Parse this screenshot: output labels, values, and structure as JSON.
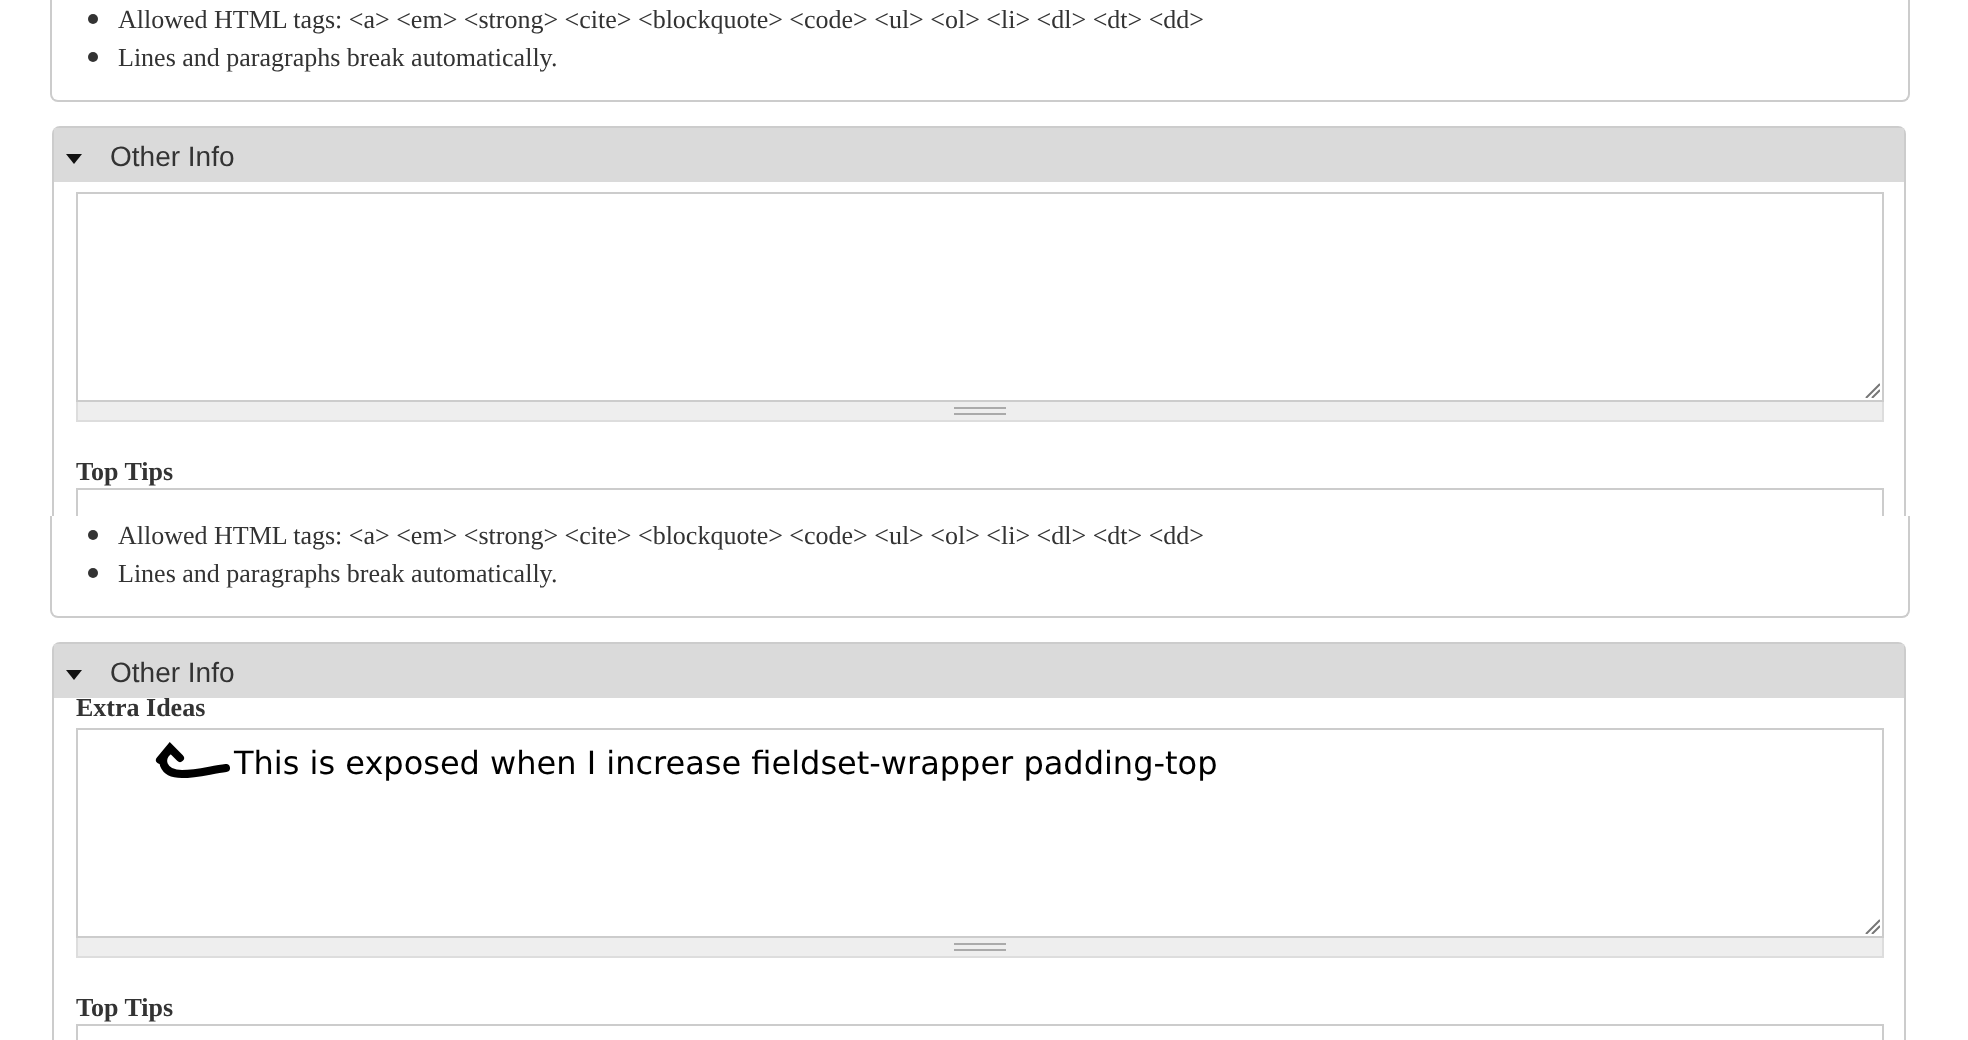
{
  "panels": [
    {
      "tips": [
        "Allowed HTML tags: <a> <em> <strong> <cite> <blockquote> <code> <ul> <ol> <li> <dl> <dt> <dd>",
        "Lines and paragraphs break automatically."
      ],
      "section": {
        "title": "Other Info",
        "expanded": true,
        "fields": [
          {
            "label": "Top Tips"
          }
        ]
      }
    },
    {
      "tips": [
        "Allowed HTML tags: <a> <em> <strong> <cite> <blockquote> <code> <ul> <ol> <li> <dl> <dt> <dd>",
        "Lines and paragraphs break automatically."
      ],
      "section": {
        "title": "Other Info",
        "expanded": true,
        "first_label": "Extra Ideas",
        "annotation": "This is exposed when I increase fieldset-wrapper padding-top",
        "fields": [
          {
            "label": "Top Tips"
          }
        ]
      }
    }
  ]
}
